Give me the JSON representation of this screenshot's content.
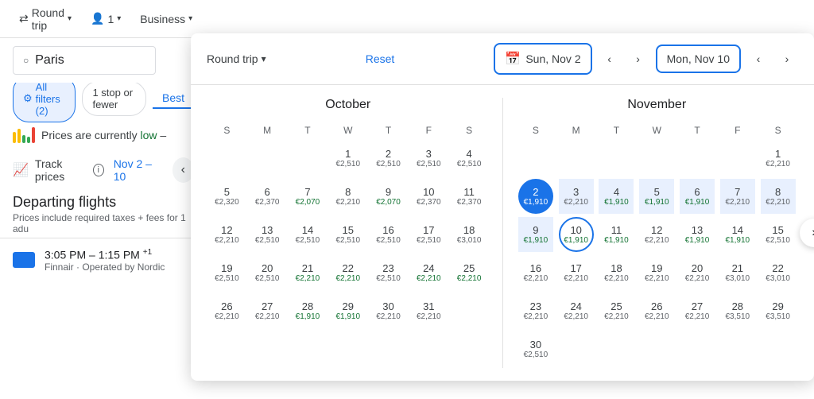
{
  "topbar": {
    "trip_type": "Round trip",
    "passengers": "1",
    "cabin_class": "Business"
  },
  "search": {
    "origin": "Paris"
  },
  "filters": {
    "all_filters": "All filters (2)",
    "stop_filter": "1 stop or fewer",
    "best_label": "Best"
  },
  "price_info": {
    "text": "Prices are currently",
    "status": "low",
    "suffix": "–"
  },
  "track": {
    "label": "Track prices",
    "date_range": "Nov 2 – 10"
  },
  "departing": {
    "title": "Departing flights",
    "subtitle": "Prices include required taxes + fees for 1 adu",
    "flight": {
      "time": "3:05 PM – 1:15 PM",
      "superscript": "+1",
      "carrier": "Finnair · Operated by Nordic"
    }
  },
  "calendar": {
    "trip_type": "Round trip",
    "reset": "Reset",
    "departure_date": "Sun, Nov 2",
    "return_date": "Mon, Nov 10",
    "oct_title": "October",
    "nov_title": "November",
    "weekdays": [
      "S",
      "M",
      "T",
      "W",
      "T",
      "F",
      "S"
    ],
    "october": [
      [
        null,
        null,
        null,
        1,
        2,
        3,
        4
      ],
      [
        5,
        6,
        7,
        8,
        9,
        10,
        11
      ],
      [
        12,
        13,
        14,
        15,
        16,
        17,
        18
      ],
      [
        19,
        20,
        21,
        22,
        23,
        24,
        25
      ],
      [
        26,
        27,
        28,
        29,
        30,
        31,
        null
      ]
    ],
    "october_prices": {
      "1": "€2,510",
      "2": "€2,510",
      "3": "€2,510",
      "4": "€2,510",
      "5": "€2,320",
      "6": "€2,370",
      "7": "€2,070",
      "8": "€2,210",
      "9": "€2,070",
      "10": "€2,370",
      "11": "€2,370",
      "12": "€2,210",
      "13": "€2,510",
      "14": "€2,510",
      "15": "€2,510",
      "16": "€2,510",
      "17": "€2,510",
      "18": "€3,010",
      "19": "€2,510",
      "20": "€2,510",
      "21": "€2,210",
      "22": "€2,210",
      "23": "€2,510",
      "24": "€2,210",
      "25": "€2,210",
      "26": "€2,210",
      "27": "€2,210",
      "28": "€1,910",
      "29": "€1,910",
      "30": "€2,210",
      "31": "€2,210"
    },
    "october_green": [
      7,
      9,
      21,
      22,
      24,
      25,
      28,
      29
    ],
    "november": [
      [
        null,
        null,
        null,
        null,
        null,
        null,
        1
      ],
      [
        2,
        3,
        4,
        5,
        6,
        7,
        8
      ],
      [
        9,
        10,
        11,
        12,
        13,
        14,
        15
      ],
      [
        16,
        17,
        18,
        19,
        20,
        21,
        22
      ],
      [
        23,
        24,
        25,
        26,
        27,
        28,
        29
      ],
      [
        30,
        null,
        null,
        null,
        null,
        null,
        null
      ]
    ],
    "november_prices": {
      "1": "€2,210",
      "2": "€1,910",
      "3": "€2,210",
      "4": "€1,910",
      "5": "€1,910",
      "6": "€1,910",
      "7": "€2,210",
      "8": "€2,210",
      "9": "€1,910",
      "10": "€1,910",
      "11": "€1,910",
      "12": "€2,210",
      "13": "€1,910",
      "14": "€1,910",
      "15": "€2,510",
      "16": "€2,210",
      "17": "€2,210",
      "18": "€2,210",
      "19": "€2,210",
      "20": "€2,210",
      "21": "€3,010",
      "22": "€3,010",
      "23": "€2,210",
      "24": "€2,210",
      "25": "€2,210",
      "26": "€2,210",
      "27": "€2,210",
      "28": "€3,510",
      "29": "€3,510",
      "30": "€2,510"
    },
    "november_green": [
      2,
      4,
      5,
      6,
      9,
      10,
      11,
      13,
      14
    ],
    "selected_start": 2,
    "selected_end": 10,
    "range_month": "november",
    "range_days": [
      3,
      4,
      5,
      6,
      7,
      8,
      9
    ]
  }
}
